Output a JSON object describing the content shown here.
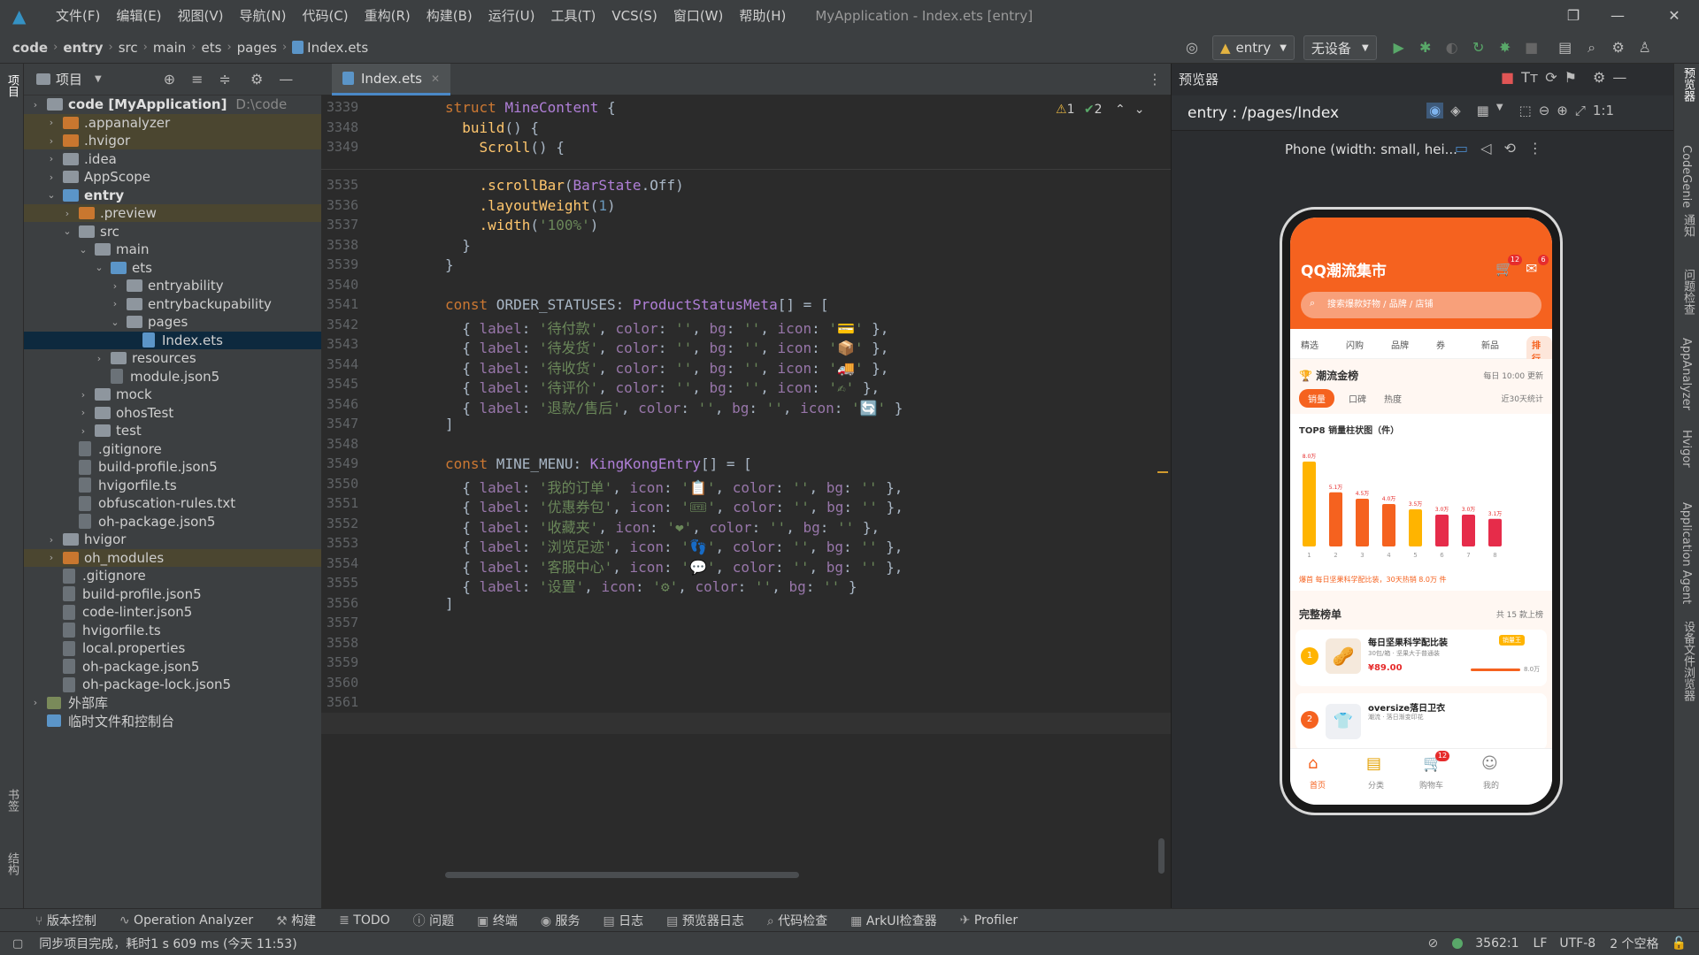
{
  "menu": {
    "items": [
      "文件(F)",
      "编辑(E)",
      "视图(V)",
      "导航(N)",
      "代码(C)",
      "重构(R)",
      "构建(B)",
      "运行(U)",
      "工具(T)",
      "VCS(S)",
      "窗口(W)",
      "帮助(H)"
    ],
    "window_title": "MyApplication - Index.ets [entry]"
  },
  "breadcrumb": [
    "code",
    "entry",
    "src",
    "main",
    "ets",
    "pages",
    "Index.ets"
  ],
  "toolbar": {
    "module": "entry",
    "device": "无设备"
  },
  "project": {
    "title": "项目",
    "tree": [
      {
        "label": "code [MyApplication]",
        "extra": "D:\\code",
        "level": 0,
        "type": "root"
      },
      {
        "label": ".appanalyzer",
        "level": 1,
        "type": "orange",
        "hl": true
      },
      {
        "label": ".hvigor",
        "level": 1,
        "type": "orange",
        "hl": true
      },
      {
        "label": ".idea",
        "level": 1,
        "type": "gray"
      },
      {
        "label": "AppScope",
        "level": 1,
        "type": "gray"
      },
      {
        "label": "entry",
        "level": 1,
        "type": "blue",
        "open": true
      },
      {
        "label": ".preview",
        "level": 2,
        "type": "orange",
        "hl": true
      },
      {
        "label": "src",
        "level": 2,
        "type": "gray",
        "open": true
      },
      {
        "label": "main",
        "level": 3,
        "type": "gray",
        "open": true
      },
      {
        "label": "ets",
        "level": 4,
        "type": "blue",
        "open": true
      },
      {
        "label": "entryability",
        "level": 5,
        "type": "gray"
      },
      {
        "label": "entrybackupability",
        "level": 5,
        "type": "gray"
      },
      {
        "label": "pages",
        "level": 5,
        "type": "gray",
        "open": true
      },
      {
        "label": "Index.ets",
        "level": 6,
        "type": "file",
        "sel": true
      },
      {
        "label": "resources",
        "level": 4,
        "type": "gray"
      },
      {
        "label": "module.json5",
        "level": 4,
        "type": "file"
      },
      {
        "label": "mock",
        "level": 3,
        "type": "gray"
      },
      {
        "label": "ohosTest",
        "level": 3,
        "type": "gray"
      },
      {
        "label": "test",
        "level": 3,
        "type": "gray"
      },
      {
        "label": ".gitignore",
        "level": 2,
        "type": "file"
      },
      {
        "label": "build-profile.json5",
        "level": 2,
        "type": "file"
      },
      {
        "label": "hvigorfile.ts",
        "level": 2,
        "type": "file"
      },
      {
        "label": "obfuscation-rules.txt",
        "level": 2,
        "type": "file"
      },
      {
        "label": "oh-package.json5",
        "level": 2,
        "type": "file"
      },
      {
        "label": "hvigor",
        "level": 1,
        "type": "gray"
      },
      {
        "label": "oh_modules",
        "level": 1,
        "type": "orange",
        "hl": true
      },
      {
        "label": ".gitignore",
        "level": 1,
        "type": "file"
      },
      {
        "label": "build-profile.json5",
        "level": 1,
        "type": "file"
      },
      {
        "label": "code-linter.json5",
        "level": 1,
        "type": "file"
      },
      {
        "label": "hvigorfile.ts",
        "level": 1,
        "type": "file"
      },
      {
        "label": "local.properties",
        "level": 1,
        "type": "file"
      },
      {
        "label": "oh-package.json5",
        "level": 1,
        "type": "file"
      },
      {
        "label": "oh-package-lock.json5",
        "level": 1,
        "type": "file"
      },
      {
        "label": "外部库",
        "level": 0,
        "type": "lib"
      },
      {
        "label": "临时文件和控制台",
        "level": 0,
        "type": "scratch"
      }
    ]
  },
  "editor": {
    "tab": "Index.ets",
    "warnings": "1",
    "checks": "2",
    "sticky": [
      {
        "n": "3339",
        "t": "struct MineContent {"
      },
      {
        "n": "3348",
        "t": "  build() {"
      },
      {
        "n": "3349",
        "t": "    Scroll() {"
      }
    ],
    "lines": [
      {
        "n": "3535",
        "t": "    .scrollBar(BarState.Off)"
      },
      {
        "n": "3536",
        "t": "    .layoutWeight(1)"
      },
      {
        "n": "3537",
        "t": "    .width('100%')"
      },
      {
        "n": "3538",
        "t": "  }"
      },
      {
        "n": "3539",
        "t": "}"
      },
      {
        "n": "3540",
        "t": ""
      },
      {
        "n": "3541",
        "t": "const ORDER_STATUSES: ProductStatusMeta[] = ["
      },
      {
        "n": "3542",
        "t": "  { label: '待付款', color: '', bg: '', icon: '💳' },"
      },
      {
        "n": "3543",
        "t": "  { label: '待发货', color: '', bg: '', icon: '📦' },"
      },
      {
        "n": "3544",
        "t": "  { label: '待收货', color: '', bg: '', icon: '🚚' },"
      },
      {
        "n": "3545",
        "t": "  { label: '待评价', color: '', bg: '', icon: '✍' },"
      },
      {
        "n": "3546",
        "t": "  { label: '退款/售后', color: '', bg: '', icon: '🔄' }"
      },
      {
        "n": "3547",
        "t": "]"
      },
      {
        "n": "3548",
        "t": ""
      },
      {
        "n": "3549",
        "t": "const MINE_MENU: KingKongEntry[] = ["
      },
      {
        "n": "3550",
        "t": "  { label: '我的订单', icon: '📋', color: '', bg: '' },"
      },
      {
        "n": "3551",
        "t": "  { label: '优惠券包', icon: '🎟', color: '', bg: '' },"
      },
      {
        "n": "3552",
        "t": "  { label: '收藏夹', icon: '❤', color: '', bg: '' },"
      },
      {
        "n": "3553",
        "t": "  { label: '浏览足迹', icon: '👣', color: '', bg: '' },"
      },
      {
        "n": "3554",
        "t": "  { label: '客服中心', icon: '💬', color: '', bg: '' },"
      },
      {
        "n": "3555",
        "t": "  { label: '设置', icon: '⚙', color: '', bg: '' }"
      },
      {
        "n": "3556",
        "t": "]"
      },
      {
        "n": "3557",
        "t": ""
      },
      {
        "n": "3558",
        "t": ""
      },
      {
        "n": "3559",
        "t": ""
      },
      {
        "n": "3560",
        "t": ""
      },
      {
        "n": "3561",
        "t": ""
      },
      {
        "n": "3562",
        "t": ""
      }
    ]
  },
  "preview": {
    "title": "预览器",
    "route": "entry : /pages/Index",
    "device": "Phone (width: small, hei...",
    "app": {
      "title": "QQ潮流集市",
      "cart_badge": "12",
      "msg_badge": "6",
      "search": "搜索爆款好物 / 品牌 / 店铺",
      "cats": [
        "精选",
        "闪购",
        "品牌",
        "券",
        "新品",
        "排行"
      ],
      "rank_title": "潮流金榜",
      "rank_update": "每日 10:00 更新",
      "rank_tabs": [
        "销量",
        "口碑",
        "热度"
      ],
      "rank_range": "近30天统计",
      "chart_title": "TOP8 销量柱状图（件）",
      "chart_note": "爆首 每日坚果科学配比装，30天热销 8.0万 件",
      "full_title": "完整榜单",
      "full_count": "共 15 款上榜",
      "item1": {
        "rank": "1",
        "name": "每日坚果科学配比装",
        "desc": "30包/箱 · 坚果大于普通装",
        "price": "¥89.00",
        "sold": "8.0万",
        "tag": "销量王"
      },
      "item2": {
        "rank": "2",
        "name": "oversize落日卫衣",
        "desc": "潮流 · 落日渐变印花"
      },
      "tabs": [
        "首页",
        "分类",
        "购物车",
        "我的"
      ],
      "tab_badge": "12"
    }
  },
  "chart_data": {
    "type": "bar",
    "title": "TOP8 销量柱状图（件）",
    "categories": [
      "1",
      "2",
      "3",
      "4",
      "5",
      "6",
      "7",
      "8"
    ],
    "values": [
      8.0,
      5.1,
      4.5,
      4.0,
      3.5,
      3.0,
      3.0,
      2.6
    ],
    "value_labels": [
      "8.0万",
      "5.1万",
      "4.5万",
      "4.0万",
      "3.5万",
      "3.0万",
      "3.0万",
      "3.1万"
    ],
    "colors": [
      "#ffb400",
      "#f5621f",
      "#f5621f",
      "#f5621f",
      "#ffb400",
      "#e62c4a",
      "#e62c4a",
      "#e62c4a"
    ],
    "ylim": [
      0,
      8.5
    ]
  },
  "bottom_tools": [
    "版本控制",
    "Operation Analyzer",
    "构建",
    "TODO",
    "问题",
    "终端",
    "服务",
    "日志",
    "预览器日志",
    "代码检查",
    "ArkUI检查器",
    "Profiler"
  ],
  "status": {
    "message": "同步项目完成，耗时1 s 609 ms (今天 11:53)",
    "position": "3562:1",
    "line_sep": "LF",
    "encoding": "UTF-8",
    "indent": "2 个空格"
  },
  "left_strip": [
    "项目",
    "书签",
    "结构"
  ],
  "right_strip": [
    "预览器",
    "CodeGenie",
    "通知",
    "问题检查",
    "AppAnalyzer",
    "Hvigor",
    "Application Agent",
    "设备文件浏览器"
  ]
}
